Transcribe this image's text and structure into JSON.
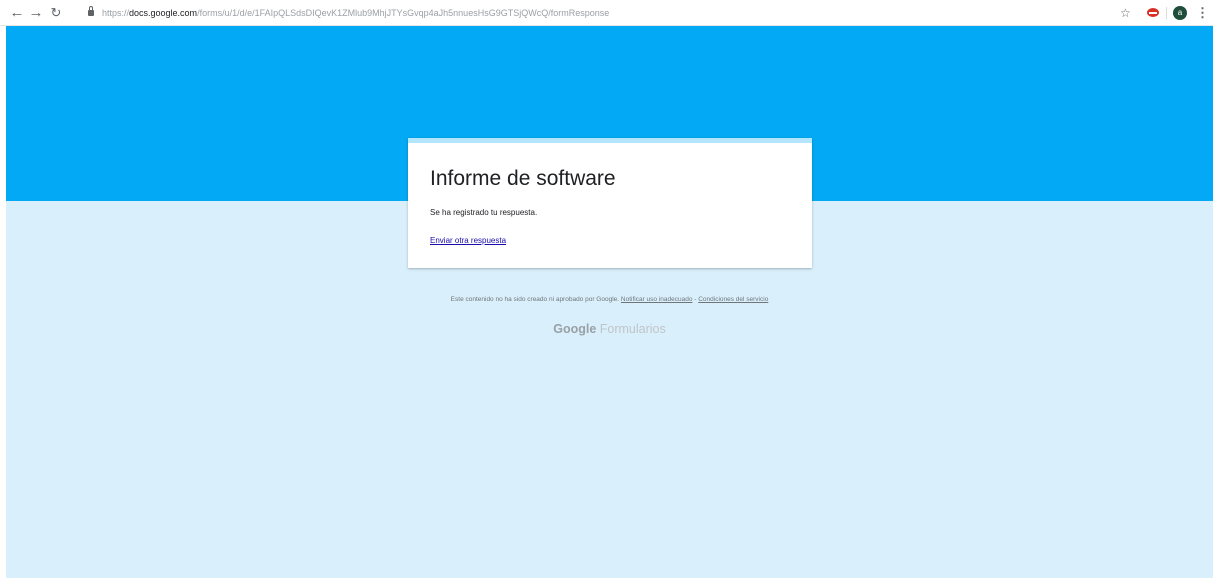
{
  "browser": {
    "url_scheme": "https://",
    "url_host": "docs.google.com",
    "url_path": "/forms/u/1/d/e/1FAIpQLSdsDIQevK1ZMlub9MhjJTYsGvqp4aJh5nnuesHsG9GTSjQWcQ/formResponse",
    "profile_initial": "a",
    "icons": {
      "back": "back-arrow-icon",
      "forward": "forward-arrow-icon",
      "reload": "reload-icon",
      "lock": "lock-icon",
      "bookmark": "star-icon",
      "extension": "adblock-extension-icon",
      "menu": "more-vert-icon"
    }
  },
  "colors": {
    "banner": "#03a9f4",
    "page_background": "#d9f0fc",
    "card_accent": "#b3e5fc",
    "link": "#1a0dab"
  },
  "form": {
    "title": "Informe de software",
    "confirmation": "Se ha registrado tu respuesta.",
    "another_response_link": "Enviar otra respuesta"
  },
  "footer": {
    "disclaimer": "Este contenido no ha sido creado ni aprobado por Google.",
    "report_link": "Notificar uso inadecuado",
    "separator": " - ",
    "terms_link": "Condiciones del servicio",
    "brand_google": "Google",
    "brand_product": "Formularios"
  }
}
